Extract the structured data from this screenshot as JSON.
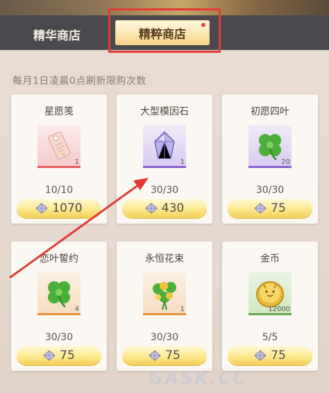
{
  "tabs": [
    {
      "label": "精华商店",
      "selected": false
    },
    {
      "label": "精粹商店",
      "selected": true,
      "badge": true
    }
  ],
  "note": "每月1日凌晨0点刷新限购次数",
  "items": [
    {
      "name": "星愿笺",
      "rarity": "pink",
      "count": "1",
      "limit": "10/10",
      "price": "1070",
      "icon": "wish-card-icon"
    },
    {
      "name": "大型模因石",
      "rarity": "purple",
      "count": "1",
      "limit": "30/30",
      "price": "430",
      "icon": "meme-crystal-icon"
    },
    {
      "name": "初愿四叶",
      "rarity": "purple",
      "count": "20",
      "limit": "30/30",
      "price": "75",
      "icon": "clover-icon"
    },
    {
      "name": "恋叶誓约",
      "rarity": "orange",
      "count": "4",
      "limit": "30/30",
      "price": "75",
      "icon": "clover-icon"
    },
    {
      "name": "永恒花束",
      "rarity": "orange",
      "count": "1",
      "limit": "30/30",
      "price": "75",
      "icon": "bouquet-icon"
    },
    {
      "name": "金币",
      "rarity": "green",
      "count": "12000",
      "limit": "5/5",
      "price": "75",
      "icon": "gold-coin-icon"
    }
  ],
  "currency_icon": "diamond-gem-icon",
  "watermark": "GASK.CC",
  "colors": {
    "highlight": "#e23b35",
    "tab_active": "#fde7b4",
    "price_button": "#fde98f"
  }
}
